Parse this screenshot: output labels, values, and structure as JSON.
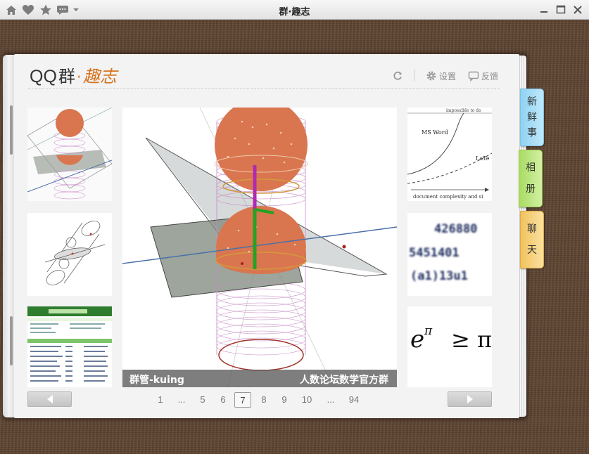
{
  "window": {
    "title": "群·趣志",
    "icons": [
      "home-icon",
      "heart-icon",
      "star-icon",
      "message-icon",
      "dropdown-arrow-icon"
    ],
    "controls": [
      "minimize-icon",
      "maximize-icon",
      "close-icon"
    ]
  },
  "header": {
    "logo_qq": "QQ",
    "logo_qun": "群",
    "logo_dot": "·",
    "logo_quzhi": "趣志",
    "settings_label": "设置",
    "feedback_label": "反馈"
  },
  "left_thumbnails": [
    "geometry-3d-thumbnail",
    "ellipse-sketch-thumbnail",
    "forum-page-thumbnail"
  ],
  "right_thumbnails": [
    {
      "name": "ms-word-chart-thumbnail",
      "texts": [
        "impossible to do",
        "MS Word",
        "LaTe",
        "document complexity and si"
      ]
    },
    {
      "name": "blurred-numbers-thumbnail",
      "texts": [
        "426880",
        "5451401",
        "(a1)13u1"
      ]
    },
    {
      "name": "math-formula-thumbnail",
      "texts": [
        "e",
        "π",
        "≥ π"
      ]
    }
  ],
  "main_photo": {
    "caption_left": "群管-kuing",
    "caption_right": "人数论坛数学官方群"
  },
  "pagination": {
    "pages": [
      "1",
      "...",
      "5",
      "6",
      "7",
      "8",
      "9",
      "10",
      "...",
      "94"
    ],
    "current": "7"
  },
  "side_tabs": {
    "news": [
      "新",
      "鲜",
      "事"
    ],
    "album": [
      "相",
      "册"
    ],
    "chat": [
      "聊",
      "天"
    ]
  },
  "colors": {
    "wood": "#5e4431",
    "accent_orange": "#d6731d",
    "tab_news": "#8fd3f2",
    "tab_album": "#a9dc63",
    "tab_chat": "#f2c25d"
  }
}
